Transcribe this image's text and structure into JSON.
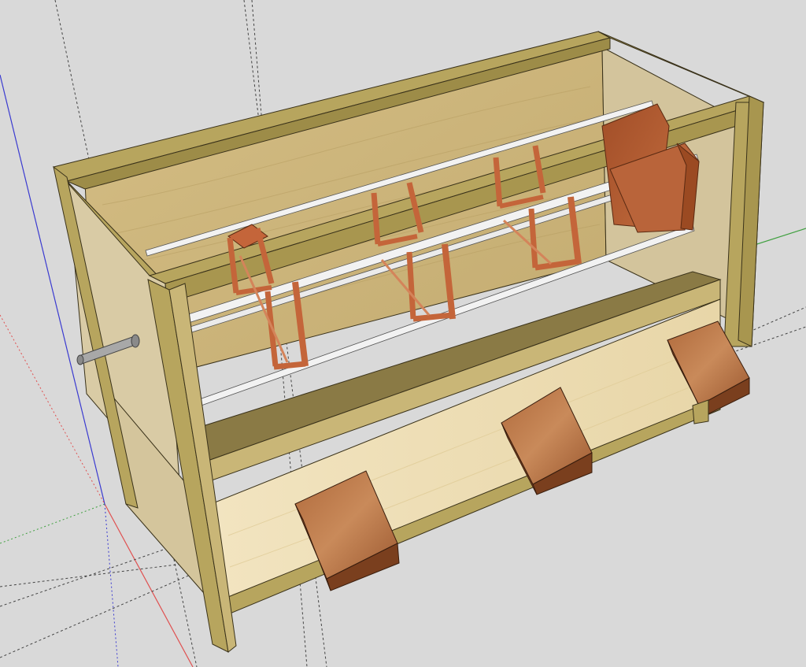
{
  "viewport": {
    "background": "#d9d9d9",
    "axis_colors": {
      "red": "#e05050",
      "green": "#40a040",
      "blue": "#3a3ad0"
    },
    "guide_color": "#444444"
  },
  "model": {
    "materials": {
      "frame": "#b7a55e",
      "frame_dark": "#8e7f40",
      "frame_edge": "#3a321a",
      "panel_back": "#cdb77f",
      "panel_side": "#d7c9a0",
      "shelf_top": "#8a7a45",
      "shelf_front": "#c9b677",
      "drawer_front": "#f0e2bd",
      "copper": "#c4653a",
      "copper_dark": "#8a3c1d",
      "rod": "#f2f2f2",
      "pedal_top": "#a9653a",
      "pedal_side": "#7a3f1e",
      "axle": "#9a9a9a"
    }
  }
}
